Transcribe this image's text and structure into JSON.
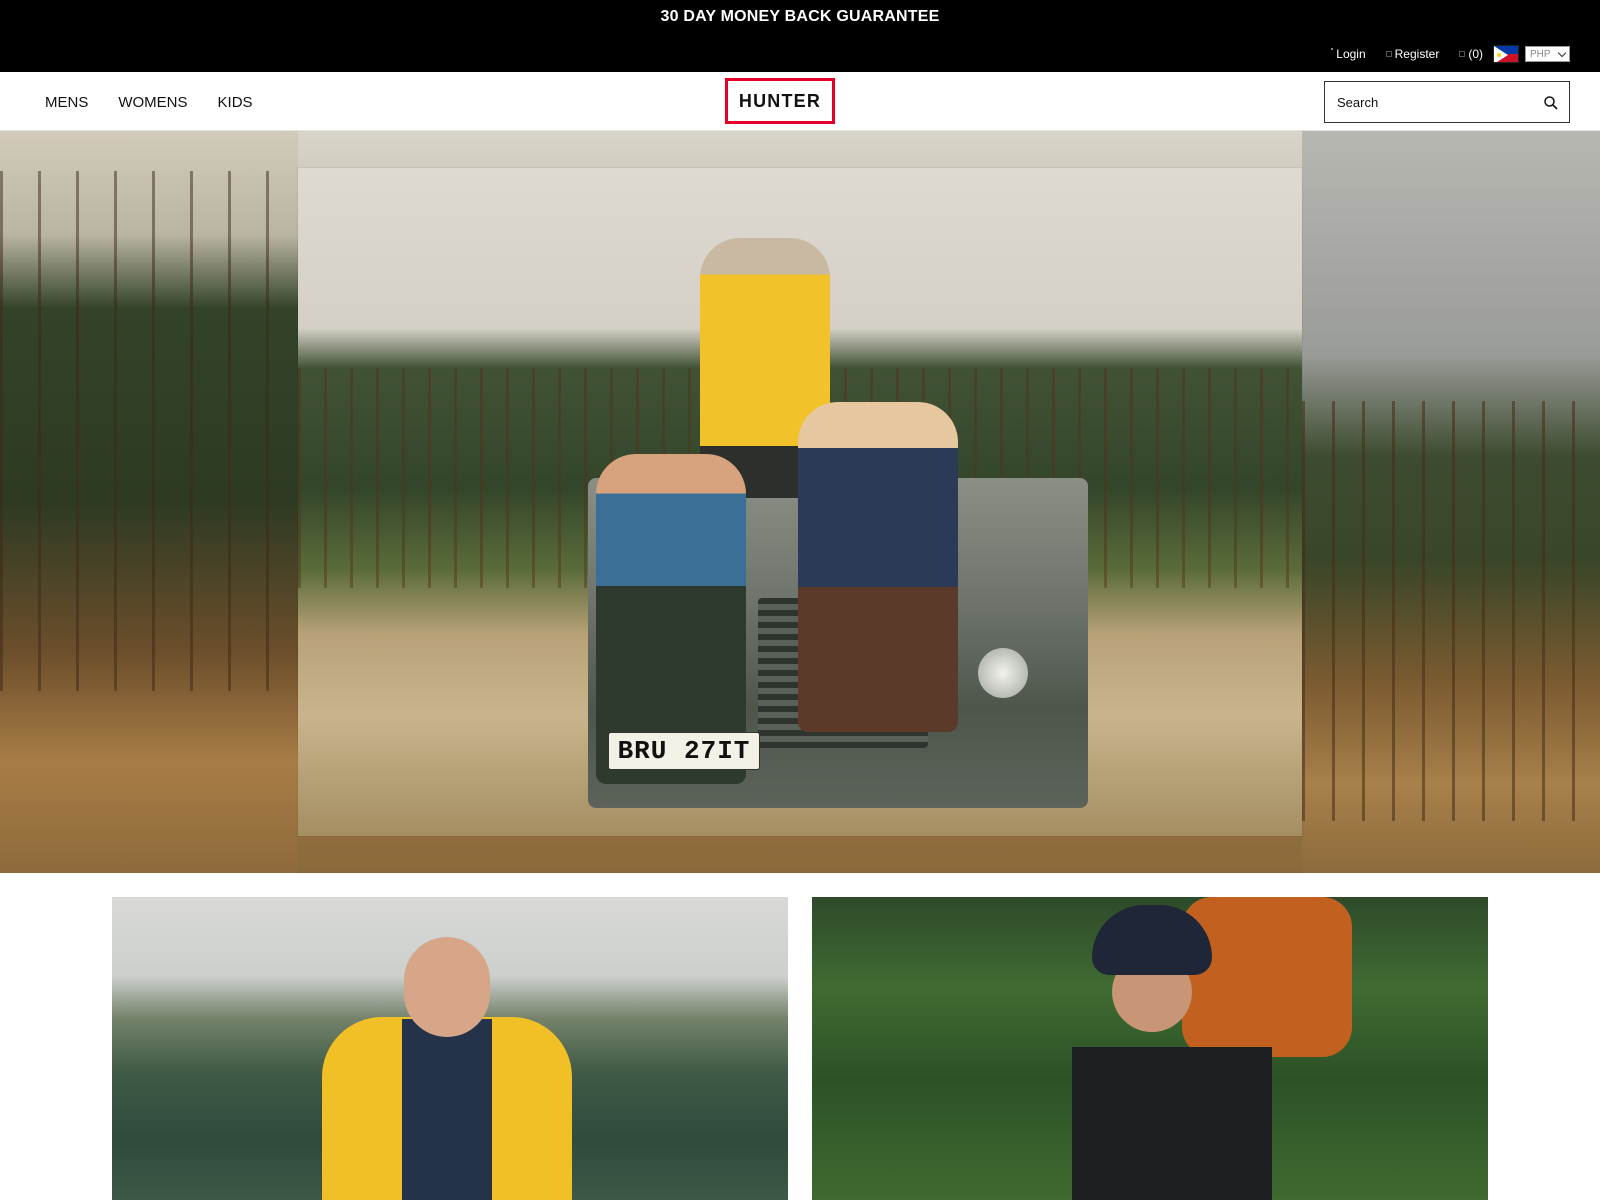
{
  "promo_bar": {
    "text": "30 DAY MONEY BACK GUARANTEE"
  },
  "account": {
    "login": "Login",
    "register": "Register",
    "cart": "(0)",
    "currency": "PHP"
  },
  "nav": {
    "items": [
      "MENS",
      "WOMENS",
      "KIDS"
    ]
  },
  "logo": {
    "text": "HUNTER"
  },
  "search": {
    "placeholder": "Search"
  },
  "hero": {
    "plate": "BRU 27IT"
  },
  "colors": {
    "brand_red": "#e4002b",
    "top_bar": "#000000"
  }
}
